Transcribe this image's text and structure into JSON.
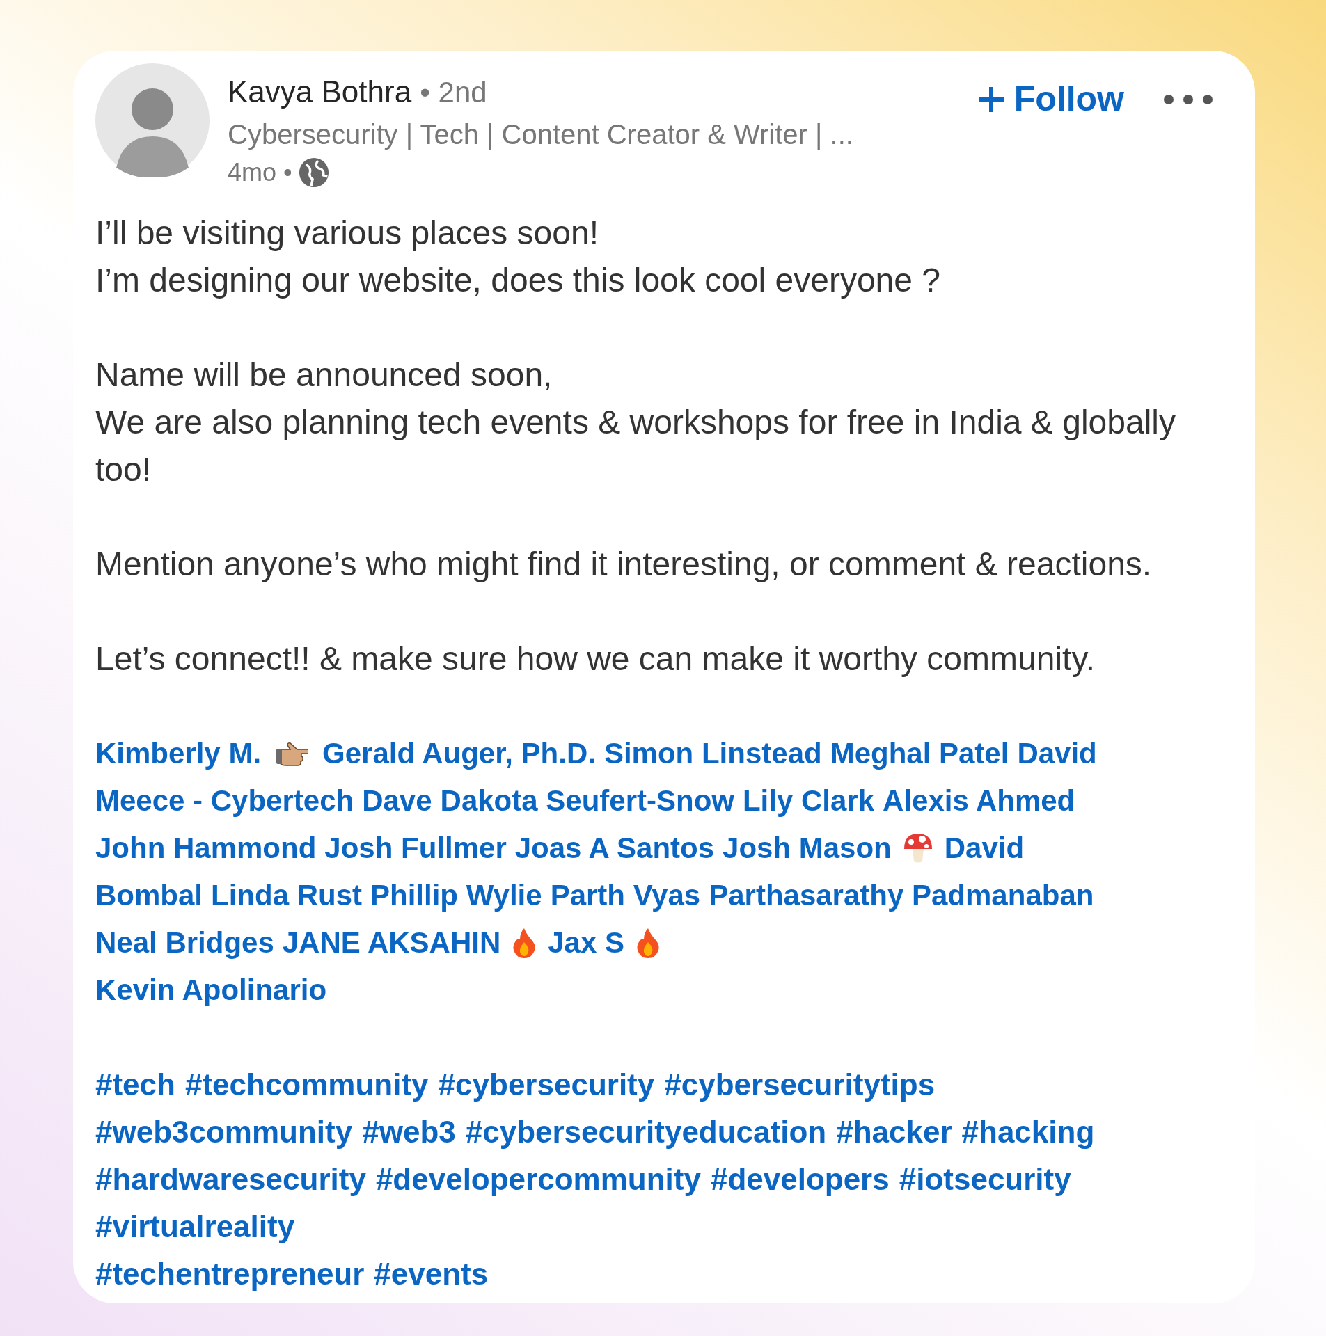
{
  "author": {
    "name": "Kavya Bothra",
    "degree": "• 2nd",
    "headline": "Cybersecurity | Tech | Content Creator & Writer | ...",
    "time": "4mo •"
  },
  "follow_button": {
    "label": "Follow"
  },
  "paragraphs": [
    [
      "I’ll be visiting various places soon!",
      "I’m designing our website, does this look cool everyone ?"
    ],
    [
      "Name will be announced soon,",
      "We are also planning tech events & workshops for free in India & globally too!"
    ],
    [
      "Mention anyone’s who might find it interesting, or comment & reactions."
    ],
    [
      "Let’s connect!! & make sure how we can make it worthy community."
    ]
  ],
  "mention_lines": [
    [
      {
        "kind": "link",
        "text": "Kimberly M."
      },
      {
        "kind": "pointing"
      },
      {
        "kind": "link",
        "text": "Gerald Auger, Ph.D."
      },
      {
        "kind": "link",
        "text": "Simon Linstead"
      },
      {
        "kind": "link",
        "text": "Meghal Patel"
      },
      {
        "kind": "link",
        "text": "David"
      }
    ],
    [
      {
        "kind": "link",
        "text": "Meece - Cybertech"
      },
      {
        "kind": "link",
        "text": "Dave"
      },
      {
        "kind": "link",
        "text": "Dakota Seufert-Snow"
      },
      {
        "kind": "link",
        "text": "Lily Clark"
      },
      {
        "kind": "link",
        "text": "Alexis Ahmed"
      }
    ],
    [
      {
        "kind": "link",
        "text": "John Hammond"
      },
      {
        "kind": "link",
        "text": "Josh Fullmer"
      },
      {
        "kind": "link",
        "text": "Joas A Santos"
      },
      {
        "kind": "link",
        "text": "Josh Mason"
      },
      {
        "kind": "mushroom"
      },
      {
        "kind": "link",
        "text": "David"
      }
    ],
    [
      {
        "kind": "link",
        "text": "Bombal"
      },
      {
        "kind": "link",
        "text": "Linda Rust"
      },
      {
        "kind": "link",
        "text": "Phillip Wylie"
      },
      {
        "kind": "link",
        "text": "Parth Vyas"
      },
      {
        "kind": "link",
        "text": "Parthasarathy Padmanaban"
      }
    ],
    [
      {
        "kind": "link",
        "text": "Neal Bridges"
      },
      {
        "kind": "link",
        "text": "JANE AKSAHIN"
      },
      {
        "kind": "flame"
      },
      {
        "kind": "link",
        "text": "Jax S"
      },
      {
        "kind": "flame"
      }
    ],
    [
      {
        "kind": "link",
        "text": "Kevin Apolinario"
      }
    ]
  ],
  "hashtag_lines": [
    [
      "#tech",
      "#techcommunity",
      "#cybersecurity",
      "#cybersecuritytips"
    ],
    [
      "#web3community",
      "#web3",
      "#cybersecurityeducation",
      "#hacker",
      "#hacking"
    ],
    [
      "#hardwaresecurity",
      "#developercommunity",
      "#developers",
      "#iotsecurity"
    ],
    [
      "#virtualreality"
    ],
    [
      "#techentrepreneur",
      "#events"
    ]
  ]
}
